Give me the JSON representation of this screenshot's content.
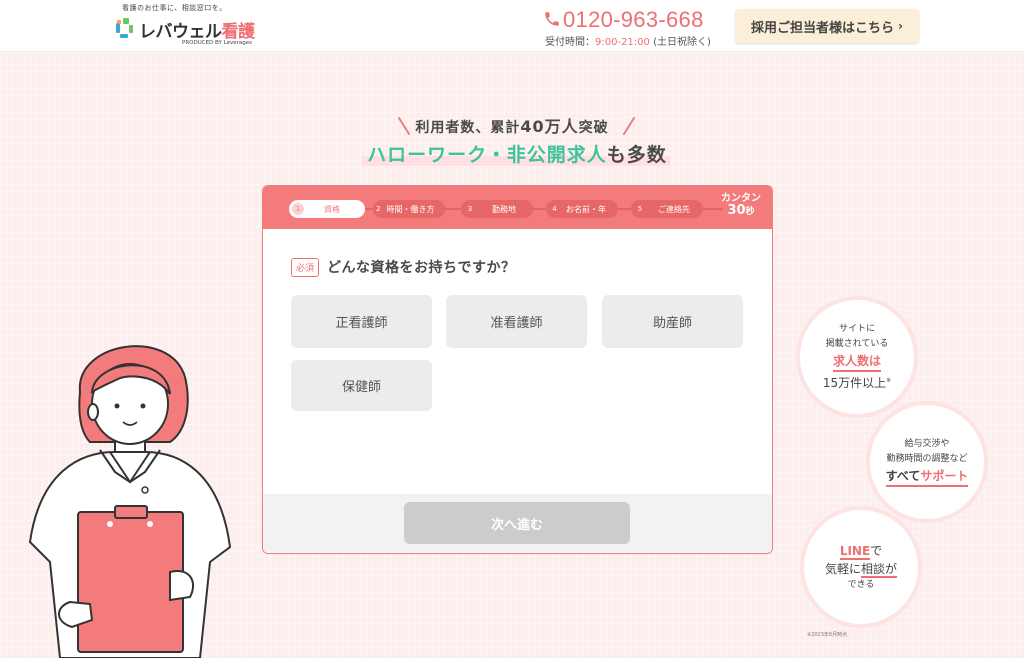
{
  "header": {
    "tagline": "看護のお仕事に、相談窓口を。",
    "logo_main": "レバウェル",
    "logo_accent": "看護",
    "logo_sub": "PRODUCED BY Leverages",
    "phone_number": "0120-963-668",
    "phone_hours_label": "受付時間：",
    "phone_hours_time": "9:00-21:00",
    "phone_hours_note": "(土日祝除く)",
    "employer_button": "採用ご担当者様はこちら",
    "employer_chevron": "›"
  },
  "hero": {
    "line1_a": "利用者数、累計",
    "line1_b": "40万人",
    "line1_c": "突破",
    "line2_green": "ハローワーク・非公開求人",
    "line2_gray": "も多数"
  },
  "form": {
    "steps": [
      {
        "num": "1",
        "label": "資格"
      },
      {
        "num": "2",
        "label": "時間・働き方"
      },
      {
        "num": "3",
        "label": "勤務地"
      },
      {
        "num": "4",
        "label": "お名前・年"
      },
      {
        "num": "5",
        "label": "ご連絡先"
      }
    ],
    "kantan_1": "カンタン",
    "kantan_2": "30",
    "kantan_unit": "秒",
    "required_badge": "必須",
    "question": "どんな資格をお持ちですか？",
    "options": [
      "正看護師",
      "准看護師",
      "助産師",
      "保健師"
    ],
    "next_button": "次へ進む"
  },
  "features": {
    "f1": {
      "l1": "サイトに",
      "l2": "掲載されている",
      "hl": "求人数は",
      "l4": "15万件以上",
      "mark": "※"
    },
    "f2": {
      "l1": "給与交渉や",
      "l2": "勤務時間の調整など",
      "l3a": "すべて",
      "l3b": "サポート"
    },
    "f3": {
      "hl": "LINE",
      "l1b": "で",
      "l2a": "気軽に",
      "l2b": "相談が",
      "l3": "できる"
    }
  },
  "footnote": "※2023年6月時点",
  "colors": {
    "accent": "#ee6f72",
    "green": "#3fc29a",
    "stepbar": "#f37b7b",
    "background": "#fdeeee"
  }
}
